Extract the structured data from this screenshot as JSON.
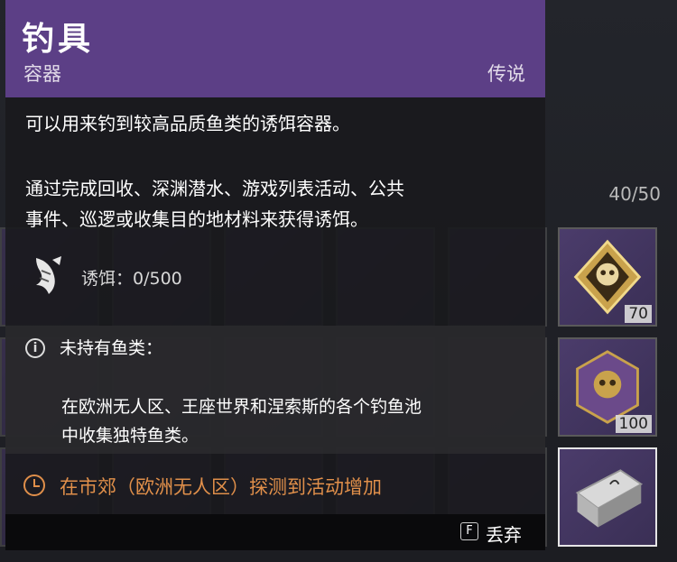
{
  "inventory": {
    "count": "40/50",
    "slots": [
      {
        "num": "70"
      },
      {
        "num": "100"
      },
      {
        "num": ""
      }
    ]
  },
  "tooltip": {
    "title": "钓具",
    "type": "容器",
    "rarity": "传说",
    "description": "可以用来钓到较高品质鱼类的诱饵容器。",
    "acquire_line1": "通过完成回收、深渊潜水、游戏列表活动、公共",
    "acquire_line2": "事件、巡逻或收集目的地材料来获得诱饵。",
    "bait_label": "诱饵：0/500",
    "unowned_title": "未持有鱼类：",
    "unowned_line1": "在欧洲无人区、王座世界和涅索斯的各个钓鱼池",
    "unowned_line2": "中收集独特鱼类。",
    "event_text": "在市郊（欧洲无人区）探测到活动增加",
    "discard_key": "F",
    "discard_label": "丢弃"
  },
  "colors": {
    "header_purple": "#5c3f86",
    "event_orange": "#e08f4a"
  },
  "icons": [
    "fish-bait-icon",
    "info-icon",
    "clock-icon",
    "skull-emblem-icon"
  ]
}
